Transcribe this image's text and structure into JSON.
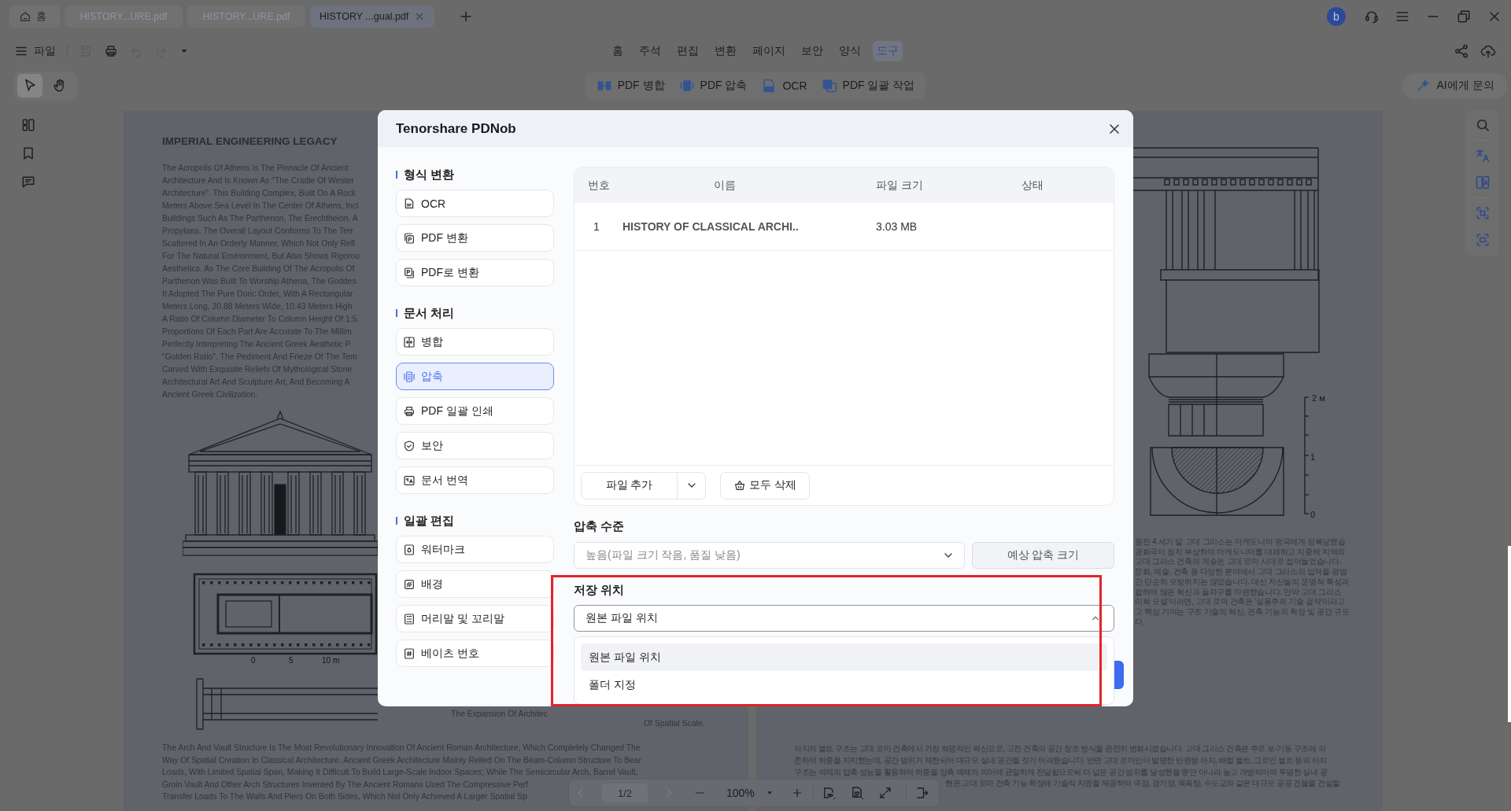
{
  "tabs": [
    {
      "kind": "home",
      "label": "홈",
      "selected": false
    },
    {
      "kind": "file",
      "label": "HISTORY...URE.pdf",
      "selected": false
    },
    {
      "kind": "file",
      "label": "HISTORY...URE.pdf",
      "selected": false
    },
    {
      "kind": "file",
      "label": "HISTORY ...gual.pdf",
      "selected": true
    }
  ],
  "account": {
    "initial": "b"
  },
  "toolbar": {
    "file_menu": "파일",
    "quick_actions": [
      {
        "kind": "save",
        "disabled": true
      },
      {
        "kind": "print",
        "disabled": false
      },
      {
        "kind": "undo",
        "disabled": true
      },
      {
        "kind": "redo",
        "disabled": true
      }
    ]
  },
  "menu": [
    {
      "label": "홈",
      "selected": false
    },
    {
      "label": "주석",
      "selected": false
    },
    {
      "label": "편집",
      "selected": false
    },
    {
      "label": "변환",
      "selected": false
    },
    {
      "label": "페이지",
      "selected": false
    },
    {
      "label": "보안",
      "selected": false
    },
    {
      "label": "양식",
      "selected": false
    },
    {
      "label": "도구",
      "selected": true
    }
  ],
  "pointer_modes": [
    {
      "kind": "select",
      "selected": true
    },
    {
      "kind": "hand",
      "selected": false
    }
  ],
  "tools": [
    {
      "kind": "merge",
      "label": "PDF 병합"
    },
    {
      "kind": "compress",
      "label": "PDF 압축"
    },
    {
      "kind": "ocr",
      "label": "OCR"
    },
    {
      "kind": "batch",
      "label": "PDF 일괄 작업"
    }
  ],
  "ai_button": {
    "label": "AI에게 문의"
  },
  "document": {
    "left_page": {
      "title": "IMPERIAL ENGINEERING LEGACY",
      "paragraph": [
        "The Acropolis Of Athens Is The Pinnacle Of Ancient",
        "Architecture And Is Known As \"The Cradle Of Wester",
        "Architecture\". This Building Complex, Built On A Rock",
        "Meters Above Sea Level In The Center Of Athens, Incl",
        "Buildings Such As The Parthenon, The Erechtheion, A",
        "Propylaea. The Overall Layout Conforms To The Terr",
        "Scattered In An Orderly Manner, Which Not Only Refl",
        "For The Natural Environment, But Also Shows Rigorou",
        "Aesthetics. As The Core Building Of The Acropolis Of",
        "Parthenon Was Built To Worship Athena, The Goddes",
        "It Adopted The Pure Doric Order, With A Rectangular",
        "Meters Long, 30.88 Meters Wide, 10.43 Meters High",
        "A Ratio Of Column Diameter To Column Height Of 1:5.",
        "Proportions Of Each Part Are Accurate To The Millim",
        "Perfectly Interpreting The Ancient Greek Aesthetic P",
        "\"Golden Ratio\". The Pediment And Frieze Of The Tem",
        "Carved With Exquisite Reliefs Of Mythological Storie",
        "Architectural Art And Sculpture Art, And Becoming A",
        "Ancient Greek Civilization."
      ],
      "plan_scale": [
        "0",
        "5",
        "10 m"
      ],
      "caption": [
        "The Expansion Of Architec",
        "Of Spatial Scale."
      ],
      "bottom_paragraph": [
        "The Arch And Vault Structure Is The Most Revolutionary Innovation Of Ancient Roman Architecture, Which Completely Changed The",
        "Way Of Spatial Creation In Classical Architecture. Ancient Greek Architecture Mainly Relied On The Beam-Column Structure To Bear",
        "Loads, With Limited Spatial Span, Making It Difficult To Build Large-Scale Indoor Spaces; While The Semicircular Arch, Barrel Vault,",
        "Groin Vault And Other Arch Structures Invented By The Ancient Romans Used The Compressive Perf",
        "Transfer Loads To The Walls And Piers On Both Sides, Which Not Only Achieved A Larger Spatial Sp"
      ]
    },
    "right_page": {
      "scale_labels": [
        "2 м",
        "1",
        "0"
      ],
      "paragraph": [
        "원전 4 세기 말 고대 그리스는 마케도니아 왕국에게 정복당했습",
        "공화국이 점차 부상하여 마케도니아를 대체하고 지중해 지역의",
        "고대 그리스 건축의 계승은 고대 로마 시대로 접어들었습니다.",
        "문화, 예술, 건축 등 다양한 분야에서 고대 그리스의 업적을 광범",
        "간 단순히 모방하지는 않았습니다. 대신 자신들의 문명적 특성과",
        "합하여 많은 혁신과 돌파구를 마련했습니다. 만약 고대 그리스",
        "미학 모델'이라면, 고대 로마 건축은 '실용주의 기술 걸작'이라고",
        "고 핵심 기여는 구조 기술의 혁신, 건축 기능의 확장 및 공간 규모",
        "다."
      ],
      "bottom_paragraph": [
        "아치와 볼트 구조는 고대 로마 건축에서 가장 혁명적인 혁신으로, 고전 건축의 공간 창조 방식을 완전히 변화시켰습니다. 고대 그리스 건축은 주로 보-기둥 구조에 의",
        "존하여 하중을 지지했는데, 공간 범위가 제한되어 대규모 실내 공간을 짓기 어려웠습니다. 반면 고대 로마인이 발명한 반원형 아치, 배럴 볼트, 그로인 볼트 등의 아치",
        "구조는 석재의 압축 성능을 활용하여 하중을 양측 벽체와 피어에 균일하게 전달함으로써 더 넓은 공간 범위를 달성했을 뿐만 아니라 높고 개방적이며 투명한 실내 공"
      ],
      "bottom_fragment": "현은 고대 로마 건축 기능 확장에 기술적 지원을 제공하여 극장, 경기장, 목욕탕, 수도교와 같은 대규모 공공 건물을 건설할"
    }
  },
  "page_nav": {
    "prev": {
      "disabled": true
    },
    "page": "1/2",
    "next": {
      "disabled": true
    },
    "zoom": "100%"
  },
  "dialog": {
    "title": "Tenorshare PDNob",
    "nav": [
      {
        "heading": "형식 변환",
        "items": [
          {
            "kind": "ocr",
            "label": "OCR",
            "selected": false
          },
          {
            "kind": "pdf_convert",
            "label": "PDF 변환",
            "selected": false
          },
          {
            "kind": "to_pdf",
            "label": "PDF로 변환",
            "selected": false
          }
        ]
      },
      {
        "heading": "문서 처리",
        "items": [
          {
            "kind": "merge",
            "label": "병합",
            "selected": false
          },
          {
            "kind": "compress",
            "label": "압축",
            "selected": true
          },
          {
            "kind": "batch_print",
            "label": "PDF 일괄 인쇄",
            "selected": false
          },
          {
            "kind": "security",
            "label": "보안",
            "selected": false
          },
          {
            "kind": "translate",
            "label": "문서 번역",
            "selected": false
          }
        ]
      },
      {
        "heading": "일괄 편집",
        "items": [
          {
            "kind": "watermark",
            "label": "워터마크",
            "selected": false
          },
          {
            "kind": "background",
            "label": "배경",
            "selected": false
          },
          {
            "kind": "header_footer",
            "label": "머리말 및 꼬리말",
            "selected": false
          },
          {
            "kind": "bates",
            "label": "베이츠 번호",
            "selected": false
          }
        ]
      }
    ],
    "table": {
      "columns": [
        "번호",
        "이름",
        "파일 크기",
        "상태"
      ],
      "rows": [
        {
          "number": "1",
          "name": "HISTORY OF CLASSICAL ARCHI..",
          "size": "3.03 MB"
        }
      ]
    },
    "add_file": "파일 추가",
    "delete_all": "모두 삭제",
    "compression": {
      "label": "압축 수준",
      "value": "높음(파일 크기 작음, 품질 낮음)",
      "estimate_button": "예상 압축 크기"
    },
    "save_location": {
      "label": "저장 위치",
      "value": "원본 파일 위치",
      "expanded": true,
      "highlighted": true,
      "options": [
        {
          "label": "원본 파일 위치",
          "selected": true
        },
        {
          "label": "폴더 지정",
          "selected": false
        }
      ]
    }
  }
}
